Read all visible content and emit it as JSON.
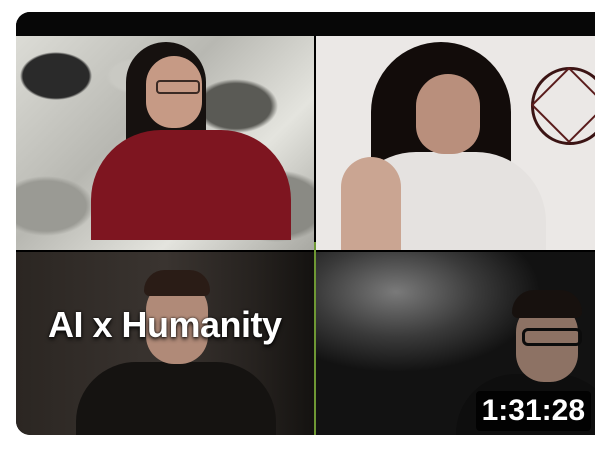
{
  "video": {
    "title": "AI x Humanity",
    "duration": "1:31:28"
  }
}
